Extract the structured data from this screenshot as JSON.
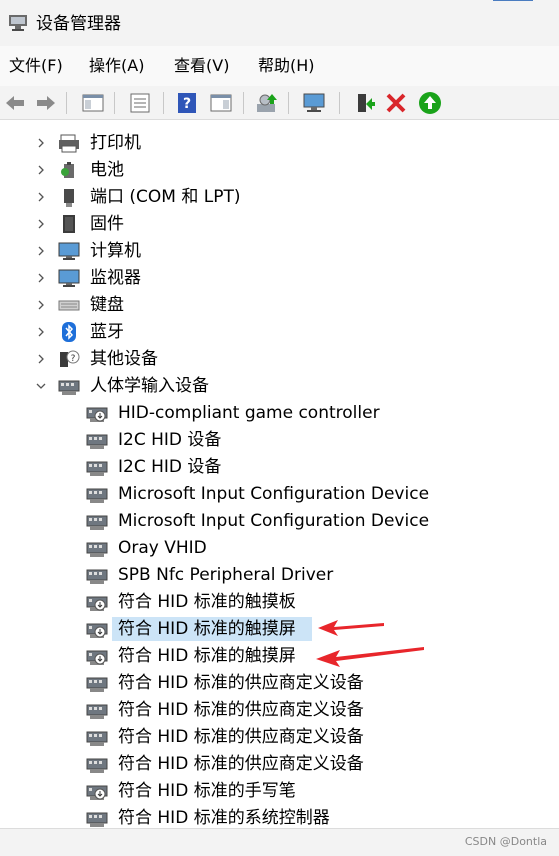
{
  "window": {
    "title": "设备管理器"
  },
  "menu": {
    "items": [
      "文件(F)",
      "操作(A)",
      "查看(V)",
      "帮助(H)"
    ]
  },
  "toolbar": {
    "buttons": [
      "back-icon",
      "forward-icon",
      "show-hide-tree-icon",
      "properties-icon",
      "help-icon",
      "action-pane-icon",
      "update-driver-icon",
      "scan-hardware-icon",
      "enable-device-icon",
      "uninstall-icon",
      "enable-green-icon"
    ]
  },
  "tree": {
    "categories": [
      {
        "label": "打印机",
        "icon": "printer-icon",
        "expanded": false
      },
      {
        "label": "电池",
        "icon": "battery-icon",
        "expanded": false
      },
      {
        "label": "端口 (COM 和 LPT)",
        "icon": "port-icon",
        "expanded": false
      },
      {
        "label": "固件",
        "icon": "firmware-icon",
        "expanded": false
      },
      {
        "label": "计算机",
        "icon": "computer-icon",
        "expanded": false
      },
      {
        "label": "监视器",
        "icon": "monitor-icon",
        "expanded": false
      },
      {
        "label": "键盘",
        "icon": "keyboard-icon",
        "expanded": false
      },
      {
        "label": "蓝牙",
        "icon": "bluetooth-icon",
        "expanded": false
      },
      {
        "label": "其他设备",
        "icon": "unknown-device-icon",
        "expanded": false
      },
      {
        "label": "人体学输入设备",
        "icon": "hid-icon",
        "expanded": true
      }
    ],
    "hid_children": [
      {
        "label": "HID-compliant game controller",
        "icon": "hid-device-down-icon"
      },
      {
        "label": "I2C HID 设备",
        "icon": "hid-device-icon"
      },
      {
        "label": "I2C HID 设备",
        "icon": "hid-device-icon"
      },
      {
        "label": "Microsoft Input Configuration Device",
        "icon": "hid-device-icon"
      },
      {
        "label": "Microsoft Input Configuration Device",
        "icon": "hid-device-icon"
      },
      {
        "label": "Oray VHID",
        "icon": "hid-device-icon"
      },
      {
        "label": "SPB Nfc Peripheral Driver",
        "icon": "hid-device-icon"
      },
      {
        "label": "符合 HID 标准的触摸板",
        "icon": "hid-device-down-icon"
      },
      {
        "label": "符合 HID 标准的触摸屏",
        "icon": "hid-device-down-icon",
        "selected": true,
        "annotated": true
      },
      {
        "label": "符合 HID 标准的触摸屏",
        "icon": "hid-device-down-icon",
        "annotated": true
      },
      {
        "label": "符合 HID 标准的供应商定义设备",
        "icon": "hid-device-icon"
      },
      {
        "label": "符合 HID 标准的供应商定义设备",
        "icon": "hid-device-icon"
      },
      {
        "label": "符合 HID 标准的供应商定义设备",
        "icon": "hid-device-icon"
      },
      {
        "label": "符合 HID 标准的供应商定义设备",
        "icon": "hid-device-icon"
      },
      {
        "label": "符合 HID 标准的手写笔",
        "icon": "hid-device-down-icon"
      },
      {
        "label": "符合 HID 标准的系统控制器",
        "icon": "hid-device-icon"
      }
    ]
  },
  "colors": {
    "accent": "#cce4f7",
    "annotation": "#e8262b",
    "green": "#1aa31a",
    "red": "#d9262b"
  },
  "statusbar": {
    "watermark": "CSDN @Dontla"
  }
}
